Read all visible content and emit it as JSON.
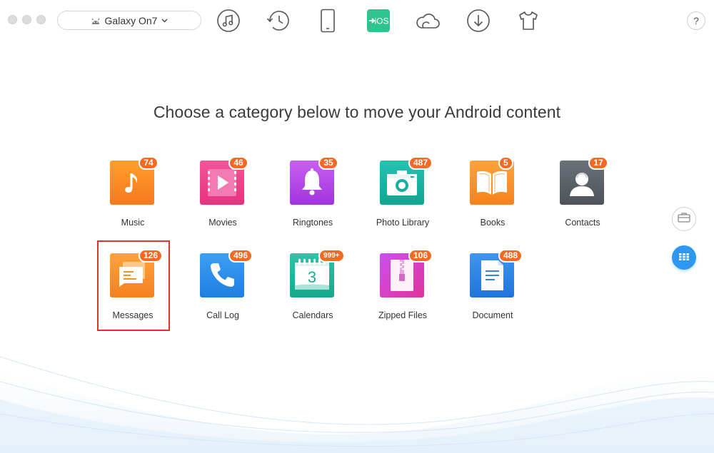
{
  "device": {
    "name": "Galaxy On7",
    "icon": "android-icon",
    "chevron": "chevron-down-icon"
  },
  "toolbar": {
    "items": [
      {
        "name": "itunes-icon"
      },
      {
        "name": "history-icon"
      },
      {
        "name": "phone-icon"
      },
      {
        "name": "android-to-ios-icon",
        "label": "iOS"
      },
      {
        "name": "icloud-icon"
      },
      {
        "name": "download-icon"
      },
      {
        "name": "tshirt-icon"
      }
    ],
    "help_label": "?"
  },
  "heading": "Choose a category below to move your Android content",
  "categories": [
    {
      "label": "Music",
      "count": "74",
      "icon": "music-icon"
    },
    {
      "label": "Movies",
      "count": "46",
      "icon": "movies-icon"
    },
    {
      "label": "Ringtones",
      "count": "35",
      "icon": "bell-icon"
    },
    {
      "label": "Photo Library",
      "count": "487",
      "icon": "camera-icon"
    },
    {
      "label": "Books",
      "count": "5",
      "icon": "book-icon"
    },
    {
      "label": "Contacts",
      "count": "17",
      "icon": "contact-icon"
    },
    {
      "label": "Messages",
      "count": "126",
      "icon": "message-icon"
    },
    {
      "label": "Call Log",
      "count": "496",
      "icon": "phone-call-icon"
    },
    {
      "label": "Calendars",
      "count": "999+",
      "icon": "calendar-icon",
      "calendar_day": "3"
    },
    {
      "label": "Zipped Files",
      "count": "106",
      "icon": "zip-icon"
    },
    {
      "label": "Document",
      "count": "488",
      "icon": "document-icon"
    }
  ],
  "selected_category": "Messages",
  "side_buttons": [
    {
      "name": "toolbox-icon"
    },
    {
      "name": "apps-grid-icon"
    }
  ],
  "colors": {
    "badge": "#f26a23",
    "selection": "#e0332c",
    "accent_blue": "#2e97f0"
  }
}
